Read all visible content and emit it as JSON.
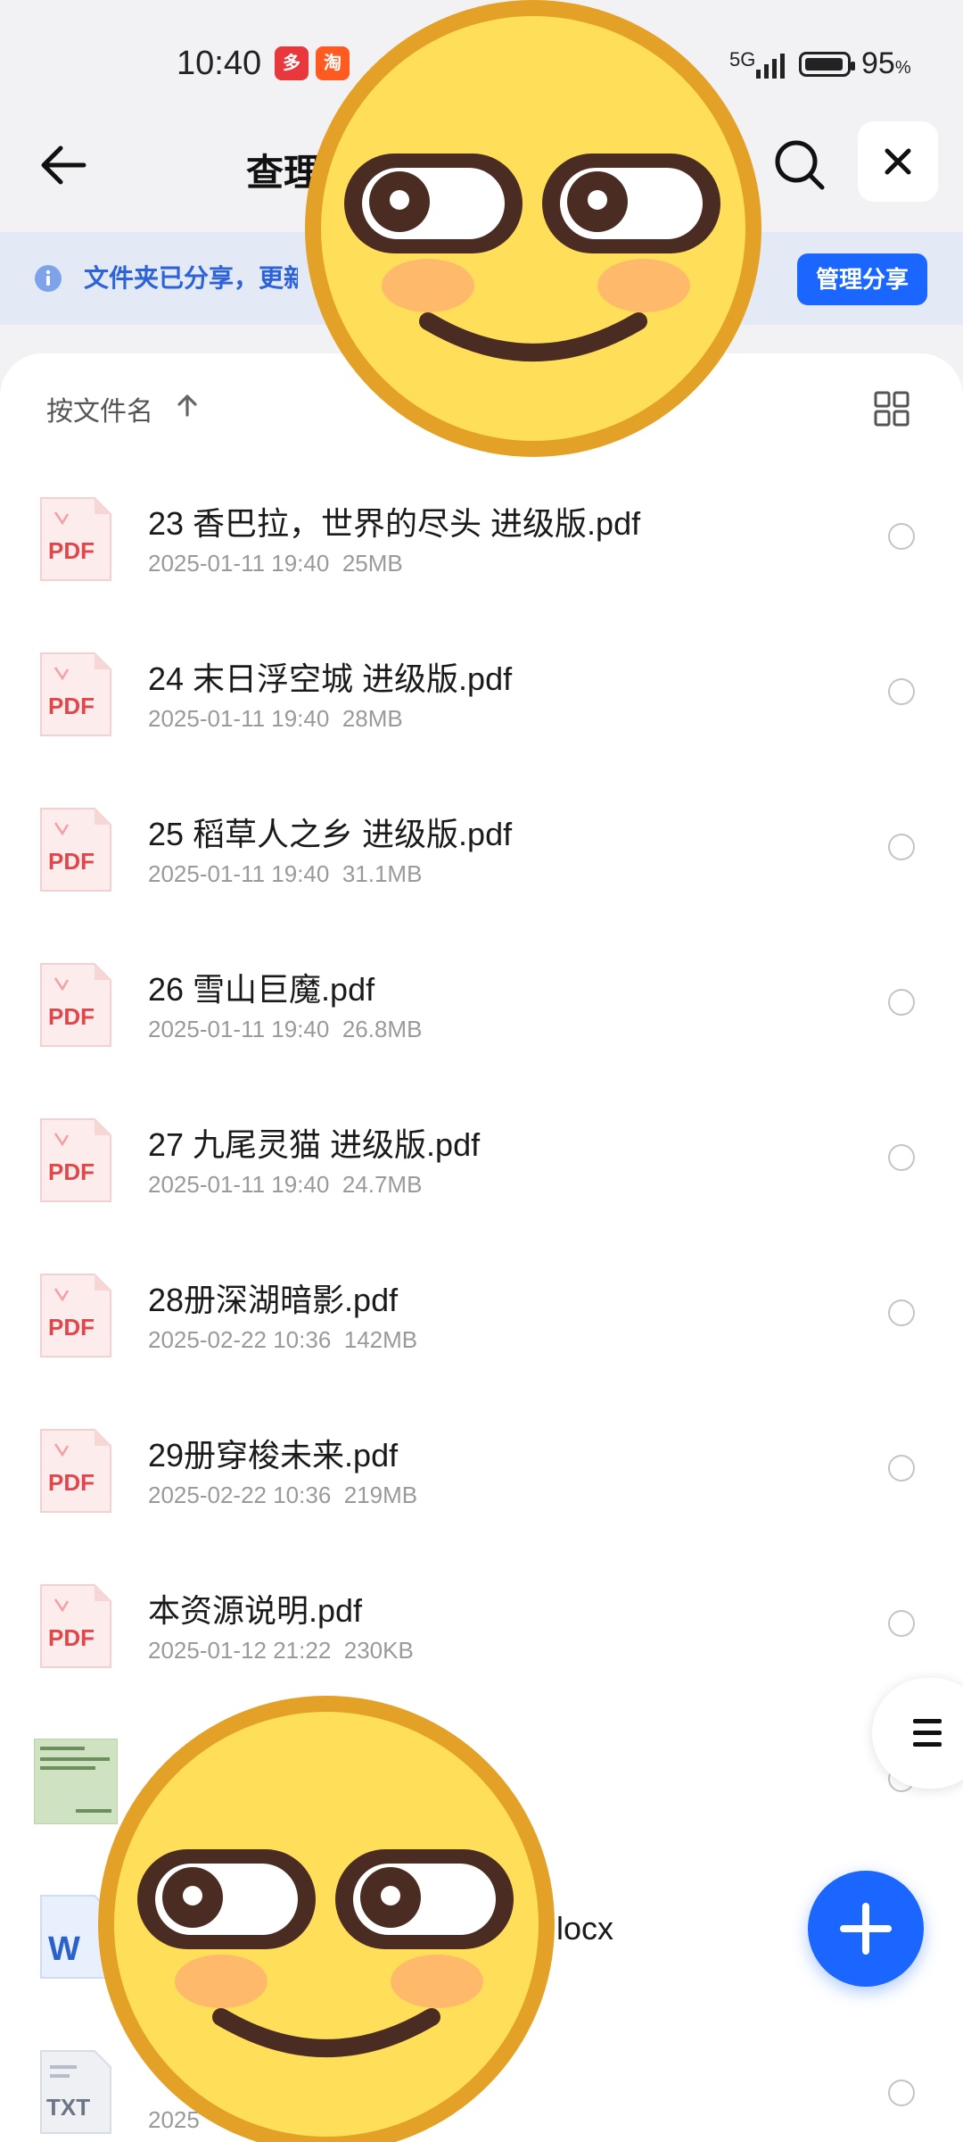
{
  "status_bar": {
    "time": "10:40",
    "network": "5G",
    "battery_percent": "95",
    "battery_unit": "%",
    "app_badges": [
      "多",
      "淘"
    ]
  },
  "header": {
    "title": "查理",
    "back_icon": "back-arrow-icon",
    "search_icon": "search-icon",
    "close_icon": "close-icon"
  },
  "banner": {
    "text": "文件夹已分享，更新",
    "manage_button": "管理分享",
    "info_icon": "info-icon"
  },
  "sort": {
    "label": "按文件名",
    "direction_icon": "arrow-up-icon",
    "view_icon": "grid-view-icon"
  },
  "files": [
    {
      "name": "23 香巴拉，世界的尽头 进级版.pdf",
      "date": "2025-01-11 19:40",
      "size": "25MB",
      "type": "PDF"
    },
    {
      "name": "24 末日浮空城 进级版.pdf",
      "date": "2025-01-11 19:40",
      "size": "28MB",
      "type": "PDF"
    },
    {
      "name": "25 稻草人之乡 进级版.pdf",
      "date": "2025-01-11 19:40",
      "size": "31.1MB",
      "type": "PDF"
    },
    {
      "name": "26 雪山巨魔.pdf",
      "date": "2025-01-11 19:40",
      "size": "26.8MB",
      "type": "PDF"
    },
    {
      "name": "27 九尾灵猫 进级版.pdf",
      "date": "2025-01-11 19:40",
      "size": "24.7MB",
      "type": "PDF"
    },
    {
      "name": "28册深湖暗影.pdf",
      "date": "2025-02-22 10:36",
      "size": "142MB",
      "type": "PDF"
    },
    {
      "name": "29册穿梭未来.pdf",
      "date": "2025-02-22 10:36",
      "size": "219MB",
      "type": "PDF"
    },
    {
      "name": "本资源说明.pdf",
      "date": "2025-01-12 21:22",
      "size": "230KB",
      "type": "PDF"
    },
    {
      "name": "",
      "date": "",
      "size": "",
      "type": "IMG"
    },
    {
      "name": "locx",
      "date": "",
      "size": "",
      "type": "W"
    },
    {
      "name": "",
      "date": "2025",
      "size": "",
      "type": "TXT"
    }
  ],
  "floating": {
    "menu_icon": "menu-lines-icon",
    "fab_icon": "plus-icon"
  },
  "colors": {
    "accent": "#1a66ff",
    "banner_bg": "#e4e9f6",
    "pdf_red": "#e0474c"
  }
}
